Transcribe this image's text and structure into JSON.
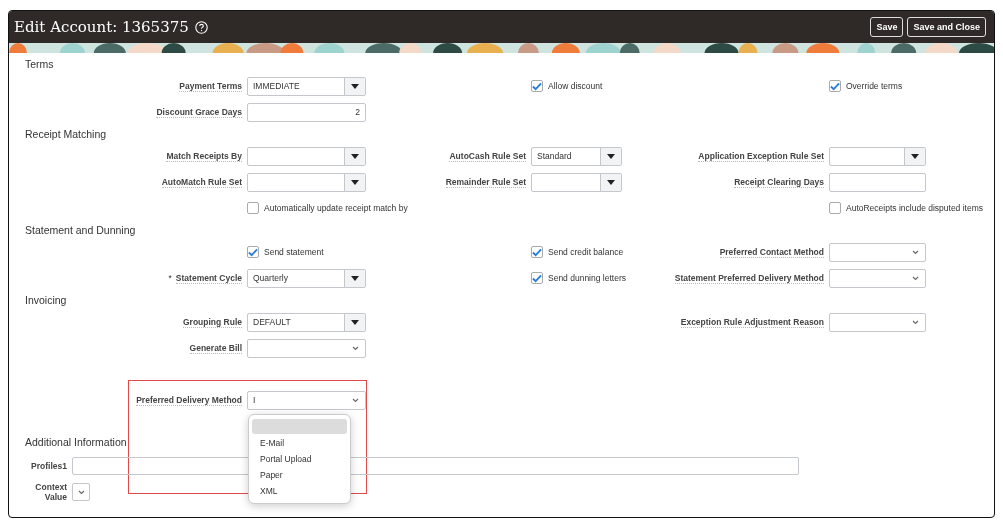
{
  "header": {
    "title": "Edit Account: 1365375",
    "buttons": [
      "Save",
      "Save and Close"
    ]
  },
  "sections": [
    {
      "title": "Terms",
      "rows": [
        {
          "cells": [
            {
              "kind": "select",
              "label": "Payment Terms",
              "value": "IMMEDIATE"
            },
            {
              "kind": "checkbox",
              "label": "Allow discount",
              "checked": true
            },
            {
              "kind": "checkbox",
              "label": "Override terms",
              "checked": true
            }
          ]
        },
        {
          "cells": [
            {
              "kind": "number",
              "label": "Discount Grace Days",
              "value": "2"
            },
            {
              "kind": "empty"
            },
            {
              "kind": "empty"
            }
          ]
        }
      ]
    },
    {
      "title": "Receipt Matching",
      "rows": [
        {
          "cells": [
            {
              "kind": "select",
              "label": "Match Receipts By"
            },
            {
              "kind": "select",
              "label": "AutoCash Rule Set",
              "value": "Standard"
            },
            {
              "kind": "select",
              "label": "Application Exception Rule Set"
            }
          ]
        },
        {
          "cells": [
            {
              "kind": "select",
              "label": "AutoMatch Rule Set"
            },
            {
              "kind": "select",
              "label": "Remainder Rule Set"
            },
            {
              "kind": "text",
              "label": "Receipt Clearing Days"
            }
          ]
        },
        {
          "cells": [
            {
              "kind": "checkbox",
              "label": "Automatically update receipt match by",
              "checked": false
            },
            {
              "kind": "empty"
            },
            {
              "kind": "checkbox",
              "label": "AutoReceipts include disputed items",
              "checked": false
            }
          ]
        }
      ]
    },
    {
      "title": "Statement and Dunning",
      "rows": [
        {
          "cells": [
            {
              "kind": "checkbox",
              "label": "Send statement",
              "checked": true
            },
            {
              "kind": "checkbox",
              "label": "Send credit balance",
              "checked": true
            },
            {
              "kind": "choice",
              "label": "Preferred Contact Method"
            }
          ]
        },
        {
          "cells": [
            {
              "kind": "select",
              "label": "Statement Cycle",
              "value": "Quarterly",
              "marker": "*"
            },
            {
              "kind": "checkbox",
              "label": "Send dunning letters",
              "checked": true
            },
            {
              "kind": "choice",
              "label": "Statement Preferred Delivery Method"
            }
          ]
        }
      ]
    },
    {
      "title": "Invoicing",
      "rows": [
        {
          "cells": [
            {
              "kind": "select",
              "label": "Grouping Rule",
              "value": "DEFAULT"
            },
            {
              "kind": "empty"
            },
            {
              "kind": "choice",
              "label": "Exception Rule Adjustment Reason"
            }
          ]
        },
        {
          "cells": [
            {
              "kind": "choice",
              "label": "Generate Bill"
            },
            {
              "kind": "empty"
            },
            {
              "kind": "empty"
            }
          ]
        },
        {
          "cells": [
            {
              "kind": "gap"
            }
          ]
        },
        {
          "cells": [
            {
              "kind": "choice",
              "label": "Preferred Delivery Method",
              "value": "I",
              "highlighted": true,
              "open": true
            },
            {
              "kind": "empty"
            },
            {
              "kind": "empty"
            }
          ]
        }
      ]
    }
  ],
  "dropdown": {
    "blank_option_highlighted": true,
    "options": [
      {
        "label": "E-Mail"
      },
      {
        "label": "Portal Upload"
      },
      {
        "label": "Paper"
      },
      {
        "label": "XML"
      }
    ]
  },
  "additional": {
    "title": "Additional Information",
    "fields": [
      {
        "kind": "text",
        "label": "Profiles1"
      },
      {
        "kind": "choice",
        "label": "Context Value"
      }
    ]
  }
}
